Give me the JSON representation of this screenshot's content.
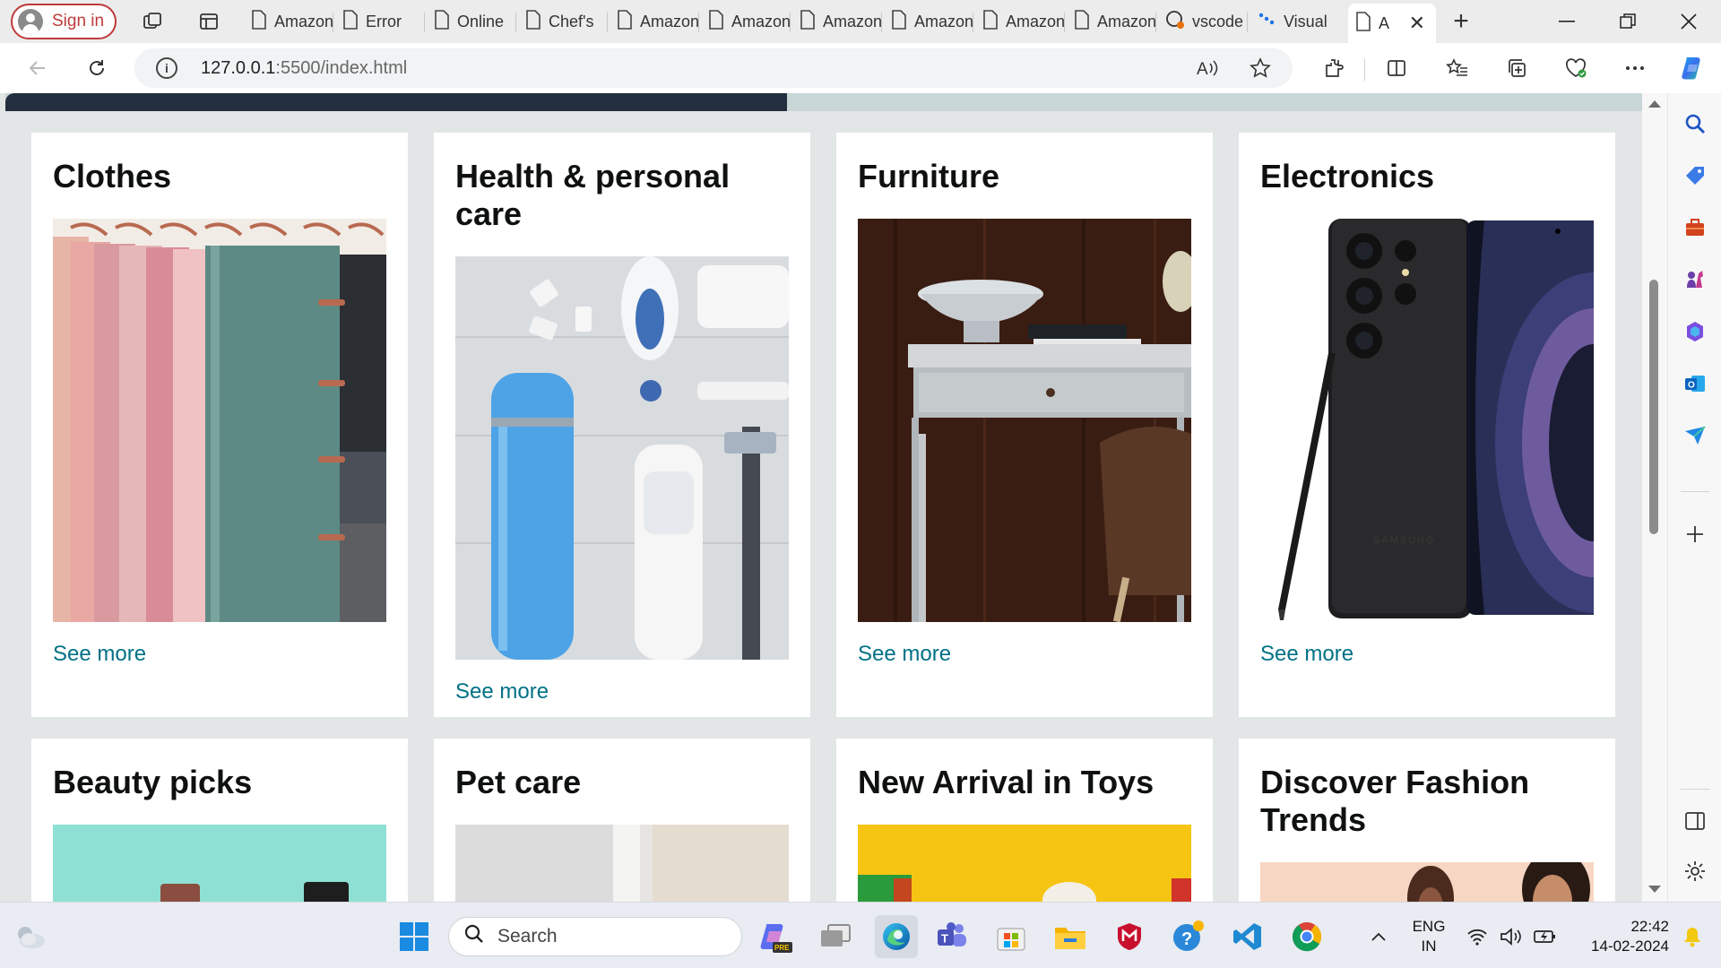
{
  "browser": {
    "signin_label": "Sign in",
    "tabs": [
      {
        "title": "Amazon"
      },
      {
        "title": "Error"
      },
      {
        "title": "Online"
      },
      {
        "title": "Chef's"
      },
      {
        "title": "Amazon"
      },
      {
        "title": "Amazon"
      },
      {
        "title": "Amazon"
      },
      {
        "title": "Amazon"
      },
      {
        "title": "Amazon"
      },
      {
        "title": "Amazon"
      },
      {
        "title": "vscode"
      },
      {
        "title": "Visual"
      },
      {
        "title": "A"
      }
    ],
    "address": {
      "host": "127.0.0.1",
      "rest": ":5500/index.html"
    }
  },
  "page": {
    "cards": [
      {
        "title": "Clothes",
        "link": "See more"
      },
      {
        "title": "Health & personal care",
        "link": "See more"
      },
      {
        "title": "Furniture",
        "link": "See more"
      },
      {
        "title": "Electronics",
        "link": "See more"
      },
      {
        "title": "Beauty picks"
      },
      {
        "title": "Pet care"
      },
      {
        "title": "New Arrival in Toys"
      },
      {
        "title": "Discover Fashion Trends"
      }
    ]
  },
  "taskbar": {
    "search_placeholder": "Search",
    "language_line1": "ENG",
    "language_line2": "IN",
    "time": "22:42",
    "date": "14-02-2024"
  },
  "colors": {
    "accent_link": "#007185",
    "header_dark": "#232f3e",
    "page_bg": "#e3e6e6"
  }
}
